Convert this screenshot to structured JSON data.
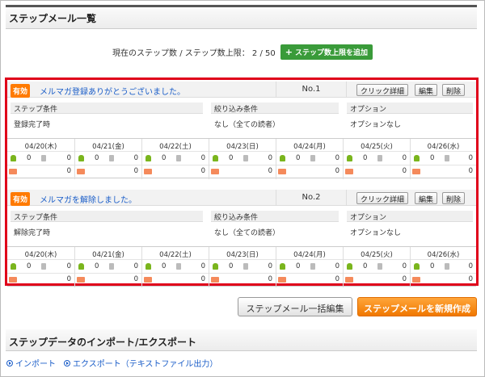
{
  "page": {
    "title": "ステップメール一覧"
  },
  "counter": {
    "text": "現在のステップ数 / ステップ数上限： 2 / 50",
    "add_label": "ステップ数上限を追加"
  },
  "steps": [
    {
      "badge": "有効",
      "title": "メルマガ登録ありがとうございました。",
      "no": "No.1",
      "buttons": {
        "detail": "クリック詳細",
        "edit": "編集",
        "delete": "削除"
      },
      "conditions": [
        {
          "head": "ステップ条件",
          "value": "登録完了時"
        },
        {
          "head": "絞り込み条件",
          "value": "なし（全ての読者）"
        },
        {
          "head": "オプション",
          "value": "オプションなし"
        }
      ],
      "days": [
        {
          "date": "04/20(木)",
          "c1": "0",
          "c2": "0",
          "c3": "0"
        },
        {
          "date": "04/21(金)",
          "c1": "0",
          "c2": "0",
          "c3": "0"
        },
        {
          "date": "04/22(土)",
          "c1": "0",
          "c2": "0",
          "c3": "0"
        },
        {
          "date": "04/23(日)",
          "c1": "0",
          "c2": "0",
          "c3": "0"
        },
        {
          "date": "04/24(月)",
          "c1": "0",
          "c2": "0",
          "c3": "0"
        },
        {
          "date": "04/25(火)",
          "c1": "0",
          "c2": "0",
          "c3": "0"
        },
        {
          "date": "04/26(水)",
          "c1": "0",
          "c2": "0",
          "c3": "0"
        }
      ]
    },
    {
      "badge": "有効",
      "title": "メルマガを解除しました。",
      "no": "No.2",
      "buttons": {
        "detail": "クリック詳細",
        "edit": "編集",
        "delete": "削除"
      },
      "conditions": [
        {
          "head": "ステップ条件",
          "value": "解除完了時"
        },
        {
          "head": "絞り込み条件",
          "value": "なし（全ての読者）"
        },
        {
          "head": "オプション",
          "value": "オプションなし"
        }
      ],
      "days": [
        {
          "date": "04/20(木)",
          "c1": "0",
          "c2": "0",
          "c3": "0"
        },
        {
          "date": "04/21(金)",
          "c1": "0",
          "c2": "0",
          "c3": "0"
        },
        {
          "date": "04/22(土)",
          "c1": "0",
          "c2": "0",
          "c3": "0"
        },
        {
          "date": "04/23(日)",
          "c1": "0",
          "c2": "0",
          "c3": "0"
        },
        {
          "date": "04/24(月)",
          "c1": "0",
          "c2": "0",
          "c3": "0"
        },
        {
          "date": "04/25(火)",
          "c1": "0",
          "c2": "0",
          "c3": "0"
        },
        {
          "date": "04/26(水)",
          "c1": "0",
          "c2": "0",
          "c3": "0"
        }
      ]
    }
  ],
  "actions": {
    "bulk_edit": "ステップメール一括編集",
    "create_new": "ステップメールを新規作成"
  },
  "section2": {
    "title": "ステップデータのインポート/エクスポート"
  },
  "links": {
    "import": "インポート",
    "export": "エクスポート（テキストファイル出力）"
  },
  "colors": {
    "accent_orange": "#ff7a00",
    "highlight_red": "#e0001a",
    "add_green": "#3a9b3a",
    "link_blue": "#1a5dc8"
  }
}
